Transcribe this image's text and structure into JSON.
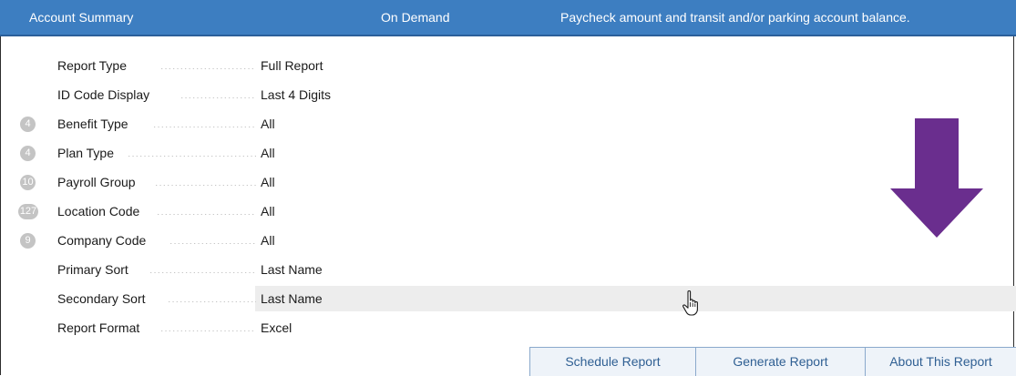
{
  "header": {
    "title": "Account Summary",
    "frequency": "On Demand",
    "description": "Paycheck amount and transit and/or parking account balance."
  },
  "rows": [
    {
      "label": "Report Type",
      "value": "Full Report",
      "badge": ""
    },
    {
      "label": "ID Code Display",
      "value": "Last 4 Digits",
      "badge": ""
    },
    {
      "label": "Benefit Type",
      "value": "All",
      "badge": "4"
    },
    {
      "label": "Plan Type",
      "value": "All",
      "badge": "4"
    },
    {
      "label": "Payroll Group",
      "value": "All",
      "badge": "10"
    },
    {
      "label": "Location Code",
      "value": "All",
      "badge": "127"
    },
    {
      "label": "Company Code",
      "value": "All",
      "badge": "9"
    },
    {
      "label": "Primary Sort",
      "value": "Last Name",
      "badge": ""
    },
    {
      "label": "Secondary Sort",
      "value": "Last Name",
      "badge": ""
    },
    {
      "label": "Report Format",
      "value": "Excel",
      "badge": ""
    }
  ],
  "buttons": {
    "schedule": "Schedule Report",
    "generate": "Generate Report",
    "about": "About This Report"
  },
  "colors": {
    "header_bg": "#3d7ec1",
    "arrow": "#6a2e8e",
    "badge": "#c4c4c4",
    "button_text": "#2f5f93"
  },
  "icons": {
    "cursor": "hand-pointer-icon",
    "arrow": "down-arrow-icon"
  }
}
